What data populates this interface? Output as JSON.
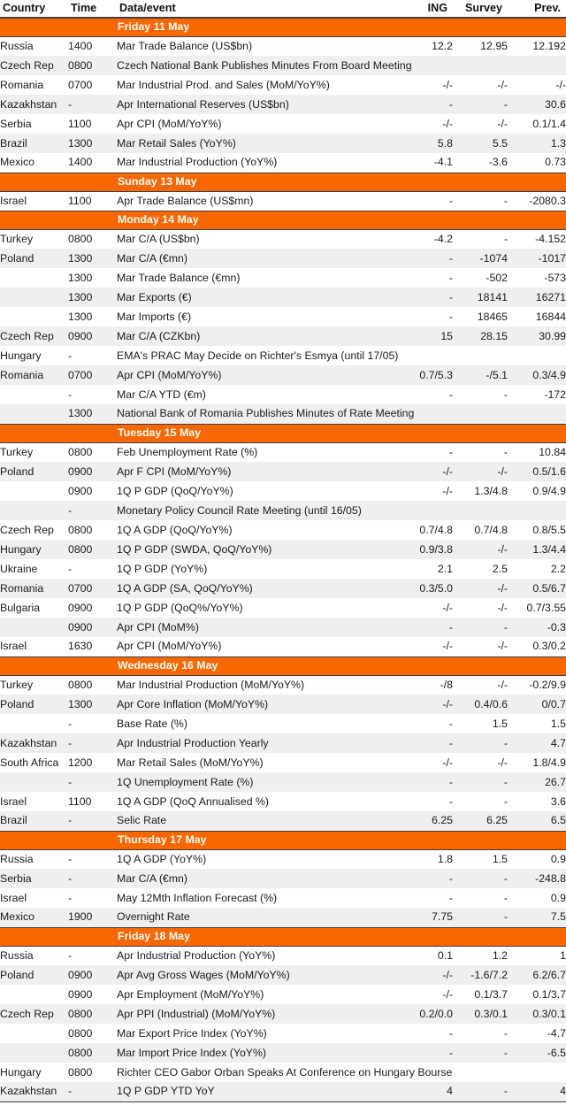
{
  "table": {
    "columns": [
      {
        "key": "country",
        "label": "Country",
        "align": "left"
      },
      {
        "key": "time",
        "label": "Time",
        "align": "left"
      },
      {
        "key": "event",
        "label": "Data/event",
        "align": "left"
      },
      {
        "key": "ing",
        "label": "ING",
        "align": "right"
      },
      {
        "key": "survey",
        "label": "Survey",
        "align": "right"
      },
      {
        "key": "prev",
        "label": "Prev.",
        "align": "right"
      }
    ],
    "accent_color": "#f96800",
    "alt_row_color": "#efefef",
    "rule_color": "#3f3f3f"
  },
  "sections": [
    {
      "day": "Friday 11 May",
      "rows": [
        {
          "country": "Russia",
          "time": "1400",
          "event": "Mar Trade Balance (US$bn)",
          "ing": "12.2",
          "survey": "12.95",
          "prev": "12.192"
        },
        {
          "country": "Czech Rep",
          "time": "0800",
          "event": "Czech National Bank Publishes Minutes From Board Meeting",
          "ing": "",
          "survey": "",
          "prev": "",
          "span": true
        },
        {
          "country": "Romania",
          "time": "0700",
          "event": "Mar Industrial Prod. and Sales (MoM/YoY%)",
          "ing": "-/-",
          "survey": "-/-",
          "prev": "-/-"
        },
        {
          "country": "Kazakhstan",
          "time": "-",
          "event": "Apr International Reserves (US$bn)",
          "ing": "-",
          "survey": "-",
          "prev": "30.6"
        },
        {
          "country": "Serbia",
          "time": "1100",
          "event": "Apr CPI (MoM/YoY%)",
          "ing": "-/-",
          "survey": "-/-",
          "prev": "0.1/1.4"
        },
        {
          "country": "Brazil",
          "time": "1300",
          "event": "Mar Retail Sales (YoY%)",
          "ing": "5.8",
          "survey": "5.5",
          "prev": "1.3"
        },
        {
          "country": "Mexico",
          "time": "1400",
          "event": "Mar Industrial Production (YoY%)",
          "ing": "-4.1",
          "survey": "-3.6",
          "prev": "0.73"
        }
      ]
    },
    {
      "day": "Sunday 13 May",
      "rows": [
        {
          "country": "Israel",
          "time": "1100",
          "event": "Apr Trade Balance (US$mn)",
          "ing": "-",
          "survey": "-",
          "prev": "-2080.3"
        }
      ]
    },
    {
      "day": "Monday 14 May",
      "rows": [
        {
          "country": "Turkey",
          "time": "0800",
          "event": "Mar C/A (US$bn)",
          "ing": "-4.2",
          "survey": "-",
          "prev": "-4.152"
        },
        {
          "country": "Poland",
          "time": "1300",
          "event": "Mar C/A (€mn)",
          "ing": "-",
          "survey": "-1074",
          "prev": "-1017"
        },
        {
          "country": "",
          "time": "1300",
          "event": "Mar Trade Balance (€mn)",
          "ing": "-",
          "survey": "-502",
          "prev": "-573"
        },
        {
          "country": "",
          "time": "1300",
          "event": "Mar Exports (€)",
          "ing": "-",
          "survey": "18141",
          "prev": "16271"
        },
        {
          "country": "",
          "time": "1300",
          "event": "Mar Imports (€)",
          "ing": "-",
          "survey": "18465",
          "prev": "16844"
        },
        {
          "country": "Czech Rep",
          "time": "0900",
          "event": "Mar C/A (CZKbn)",
          "ing": "15",
          "survey": "28.15",
          "prev": "30.99"
        },
        {
          "country": "Hungary",
          "time": "-",
          "event": "EMA's PRAC May Decide on Richter's Esmya (until 17/05)",
          "ing": "",
          "survey": "",
          "prev": "",
          "span": true
        },
        {
          "country": "Romania",
          "time": "0700",
          "event": "Apr CPI (MoM/YoY%)",
          "ing": "0.7/5.3",
          "survey": "-/5.1",
          "prev": "0.3/4.9"
        },
        {
          "country": "",
          "time": "-",
          "event": "Mar C/A YTD (€m)",
          "ing": "-",
          "survey": "-",
          "prev": "-172"
        },
        {
          "country": "",
          "time": "1300",
          "event": "National Bank of Romania Publishes Minutes of Rate Meeting",
          "ing": "",
          "survey": "",
          "prev": "",
          "span": true
        }
      ]
    },
    {
      "day": "Tuesday 15 May",
      "rows": [
        {
          "country": "Turkey",
          "time": "0800",
          "event": "Feb Unemployment Rate (%)",
          "ing": "-",
          "survey": "-",
          "prev": "10.84"
        },
        {
          "country": "Poland",
          "time": "0900",
          "event": "Apr F CPI (MoM/YoY%)",
          "ing": "-/-",
          "survey": "-/-",
          "prev": "0.5/1.6"
        },
        {
          "country": "",
          "time": "0900",
          "event": "1Q P GDP (QoQ/YoY%)",
          "ing": "-/-",
          "survey": "1.3/4.8",
          "prev": "0.9/4.9"
        },
        {
          "country": "",
          "time": "-",
          "event": "Monetary Policy Council Rate Meeting (until 16/05)",
          "ing": "",
          "survey": "",
          "prev": "",
          "span": true
        },
        {
          "country": "Czech Rep",
          "time": "0800",
          "event": "1Q A GDP (QoQ/YoY%)",
          "ing": "0.7/4.8",
          "survey": "0.7/4.8",
          "prev": "0.8/5.5"
        },
        {
          "country": "Hungary",
          "time": "0800",
          "event": "1Q P GDP (SWDA, QoQ/YoY%)",
          "ing": "0.9/3.8",
          "survey": "-/-",
          "prev": "1.3/4.4"
        },
        {
          "country": "Ukraine",
          "time": "-",
          "event": "1Q P GDP (YoY%)",
          "ing": "2.1",
          "survey": "2.5",
          "prev": "2.2"
        },
        {
          "country": "Romania",
          "time": "0700",
          "event": "1Q A GDP (SA, QoQ/YoY%)",
          "ing": "0.3/5.0",
          "survey": "-/-",
          "prev": "0.5/6.7"
        },
        {
          "country": "Bulgaria",
          "time": "0900",
          "event": "1Q P GDP (QoQ%/YoY%)",
          "ing": "-/-",
          "survey": "-/-",
          "prev": "0.7/3.55"
        },
        {
          "country": "",
          "time": "0900",
          "event": "Apr CPI (MoM%)",
          "ing": "-",
          "survey": "-",
          "prev": "-0.3"
        },
        {
          "country": "Israel",
          "time": "1630",
          "event": "Apr CPI (MoM/YoY%)",
          "ing": "-/-",
          "survey": "-/-",
          "prev": "0.3/0.2"
        }
      ]
    },
    {
      "day": "Wednesday 16 May",
      "rows": [
        {
          "country": "Turkey",
          "time": "0800",
          "event": "Mar Industrial Production (MoM/YoY%)",
          "ing": "-/8",
          "survey": "-/-",
          "prev": "-0.2/9.9"
        },
        {
          "country": "Poland",
          "time": "1300",
          "event": "Apr Core Inflation (MoM/YoY%)",
          "ing": "-/-",
          "survey": "0.4/0.6",
          "prev": "0/0.7"
        },
        {
          "country": "",
          "time": "-",
          "event": "Base Rate (%)",
          "ing": "-",
          "survey": "1.5",
          "prev": "1.5"
        },
        {
          "country": "Kazakhstan",
          "time": "-",
          "event": "Apr Industrial Production Yearly",
          "ing": "-",
          "survey": "-",
          "prev": "4.7"
        },
        {
          "country": "South Africa",
          "time": "1200",
          "event": "Mar Retail Sales (MoM/YoY%)",
          "ing": "-/-",
          "survey": "-/-",
          "prev": "1.8/4.9"
        },
        {
          "country": "",
          "time": "-",
          "event": "1Q Unemployment Rate (%)",
          "ing": "-",
          "survey": "-",
          "prev": "26.7"
        },
        {
          "country": "Israel",
          "time": "1100",
          "event": "1Q A GDP (QoQ Annualised %)",
          "ing": "-",
          "survey": "-",
          "prev": "3.6"
        },
        {
          "country": "Brazil",
          "time": "-",
          "event": "Selic Rate",
          "ing": "6.25",
          "survey": "6.25",
          "prev": "6.5"
        }
      ]
    },
    {
      "day": "Thursday 17 May",
      "rows": [
        {
          "country": "Russia",
          "time": "-",
          "event": "1Q A GDP (YoY%)",
          "ing": "1.8",
          "survey": "1.5",
          "prev": "0.9"
        },
        {
          "country": "Serbia",
          "time": "-",
          "event": "Mar C/A (€mn)",
          "ing": "-",
          "survey": "-",
          "prev": "-248.8"
        },
        {
          "country": "Israel",
          "time": "-",
          "event": "May 12Mth Inflation Forecast (%)",
          "ing": "-",
          "survey": "-",
          "prev": "0.9"
        },
        {
          "country": "Mexico",
          "time": "1900",
          "event": "Overnight Rate",
          "ing": "7.75",
          "survey": "-",
          "prev": "7.5"
        }
      ]
    },
    {
      "day": "Friday 18 May",
      "rows": [
        {
          "country": "Russia",
          "time": "-",
          "event": "Apr Industrial Production (YoY%)",
          "ing": "0.1",
          "survey": "1.2",
          "prev": "1"
        },
        {
          "country": "Poland",
          "time": "0900",
          "event": "Apr Avg Gross Wages (MoM/YoY%)",
          "ing": "-/-",
          "survey": "-1.6/7.2",
          "prev": "6.2/6.7"
        },
        {
          "country": "",
          "time": "0900",
          "event": "Apr Employment (MoM/YoY%)",
          "ing": "-/-",
          "survey": "0.1/3.7",
          "prev": "0.1/3.7"
        },
        {
          "country": "Czech Rep",
          "time": "0800",
          "event": "Apr PPI (Industrial) (MoM/YoY%)",
          "ing": "0.2/0.0",
          "survey": "0.3/0.1",
          "prev": "0.3/0.1"
        },
        {
          "country": "",
          "time": "0800",
          "event": "Mar Export Price Index (YoY%)",
          "ing": "-",
          "survey": "-",
          "prev": "-4.7"
        },
        {
          "country": "",
          "time": "0800",
          "event": "Mar Import Price Index (YoY%)",
          "ing": "-",
          "survey": "-",
          "prev": "-6.5"
        },
        {
          "country": "Hungary",
          "time": "0800",
          "event": "Richter CEO Gabor Orban Speaks At Conference on Hungary Bourse",
          "ing": "",
          "survey": "",
          "prev": "",
          "span": true
        },
        {
          "country": "Kazakhstan",
          "time": "-",
          "event": "1Q P GDP YTD YoY",
          "ing": "4",
          "survey": "-",
          "prev": "4"
        }
      ]
    }
  ]
}
